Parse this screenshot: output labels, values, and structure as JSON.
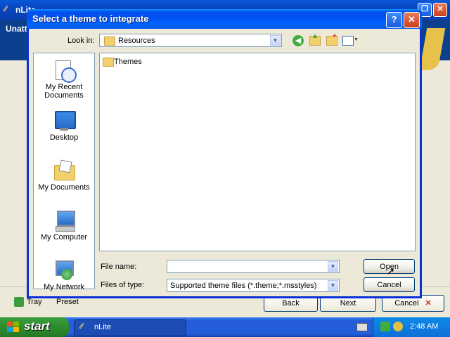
{
  "background_window": {
    "title": "nLite",
    "banner_text": "Unatt",
    "footer": {
      "tray_label": "Tray",
      "preset_label": "Preset",
      "back_label": "Back",
      "next_label": "Next",
      "cancel_label": "Cancel"
    }
  },
  "dialog": {
    "title": "Select a theme to integrate",
    "look_in_label": "Look in:",
    "look_in_value": "Resources",
    "toolbar_icons": [
      "back-icon",
      "up-folder-icon",
      "new-folder-icon",
      "views-menu-icon"
    ],
    "places": [
      {
        "label": "My Recent Documents",
        "icon": "recent-documents-icon"
      },
      {
        "label": "Desktop",
        "icon": "desktop-icon"
      },
      {
        "label": "My Documents",
        "icon": "my-documents-icon"
      },
      {
        "label": "My Computer",
        "icon": "my-computer-icon"
      },
      {
        "label": "My Network",
        "icon": "my-network-icon"
      }
    ],
    "files": [
      {
        "name": "Themes",
        "icon": "folder-icon"
      }
    ],
    "file_name_label": "File name:",
    "file_name_value": "",
    "files_of_type_label": "Files of type:",
    "files_of_type_value": "Supported theme files (*.theme;*.msstyles)",
    "open_label": "Open",
    "cancel_label": "Cancel"
  },
  "taskbar": {
    "start_label": "start",
    "task_label": "nLite",
    "clock": "2:48 AM"
  },
  "colors": {
    "title_blue": "#0053ee",
    "start_green": "#2f8a2f",
    "dialog_face": "#ece9d8"
  }
}
